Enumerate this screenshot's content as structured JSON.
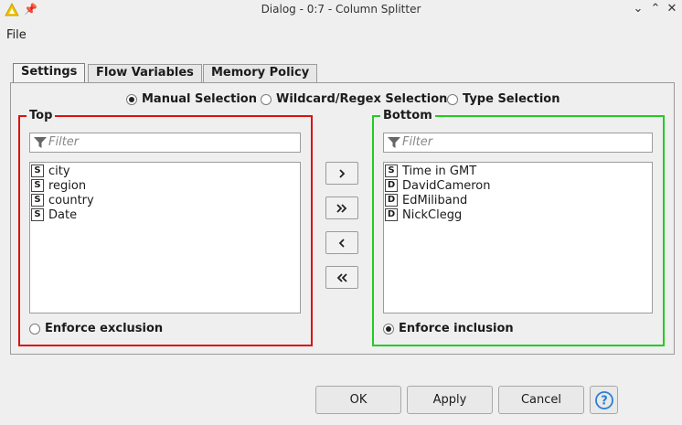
{
  "window": {
    "title": "Dialog - 0:7 - Column Splitter"
  },
  "menu": {
    "file": "File"
  },
  "tabs": [
    {
      "label": "Settings",
      "active": true
    },
    {
      "label": "Flow Variables",
      "active": false
    },
    {
      "label": "Memory Policy",
      "active": false
    }
  ],
  "selection_modes": {
    "manual": "Manual Selection",
    "wildcard": "Wildcard/Regex Selection",
    "type": "Type Selection",
    "selected": "manual"
  },
  "top": {
    "title": "Top",
    "filter_placeholder": "Filter",
    "items": [
      {
        "type": "S",
        "label": "city"
      },
      {
        "type": "S",
        "label": "region"
      },
      {
        "type": "S",
        "label": "country"
      },
      {
        "type": "S",
        "label": "Date"
      }
    ],
    "enforce_label": "Enforce exclusion",
    "enforce_selected": false
  },
  "bottom": {
    "title": "Bottom",
    "filter_placeholder": "Filter",
    "items": [
      {
        "type": "S",
        "label": "Time in GMT"
      },
      {
        "type": "D",
        "label": "DavidCameron"
      },
      {
        "type": "D",
        "label": "EdMiliband"
      },
      {
        "type": "D",
        "label": "NickClegg"
      }
    ],
    "enforce_label": "Enforce inclusion",
    "enforce_selected": true
  },
  "transfer_buttons": {
    "add": "›",
    "add_all": "»",
    "remove": "‹",
    "remove_all": "«"
  },
  "footer": {
    "ok": "OK",
    "apply": "Apply",
    "cancel": "Cancel",
    "help": "?"
  },
  "colors": {
    "top_border": "#dd1111",
    "bottom_border": "#22cc22",
    "help_blue": "#2a7fd4",
    "app_icon_yellow": "#f2c500"
  }
}
